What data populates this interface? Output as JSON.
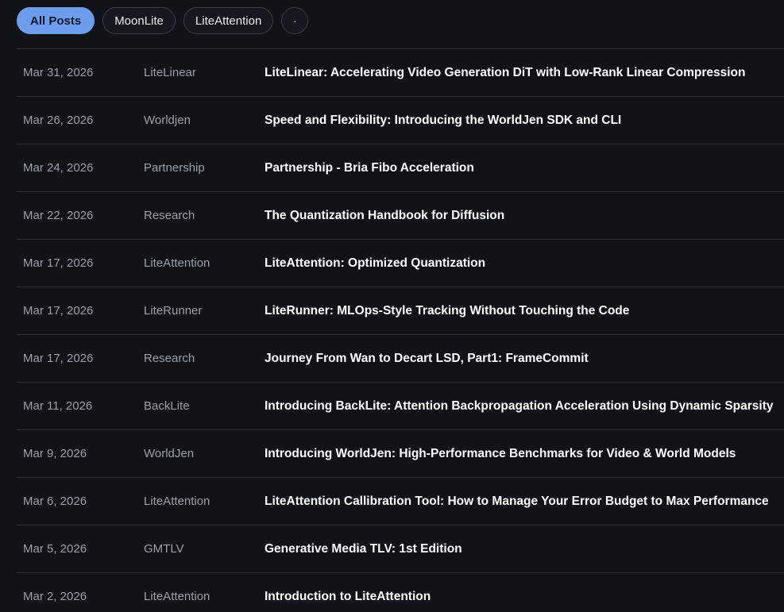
{
  "filters": {
    "all_posts": "All Posts",
    "moonlite": "MoonLite",
    "liteattention": "LiteAttention",
    "more": "·"
  },
  "posts": [
    {
      "date": "Mar 31, 2026",
      "category": "LiteLinear",
      "title": "LiteLinear: Accelerating Video Generation DiT with Low-Rank Linear Compression"
    },
    {
      "date": "Mar 26, 2026",
      "category": "Worldjen",
      "title": "Speed and Flexibility: Introducing the WorldJen SDK and CLI"
    },
    {
      "date": "Mar 24, 2026",
      "category": "Partnership",
      "title": "Partnership - Bria Fibo Acceleration"
    },
    {
      "date": "Mar 22, 2026",
      "category": "Research",
      "title": "The Quantization Handbook for Diffusion"
    },
    {
      "date": "Mar 17, 2026",
      "category": "LiteAttention",
      "title": "LiteAttention: Optimized Quantization"
    },
    {
      "date": "Mar 17, 2026",
      "category": "LiteRunner",
      "title": "LiteRunner: MLOps-Style Tracking Without Touching the Code"
    },
    {
      "date": "Mar 17, 2026",
      "category": "Research",
      "title": "Journey From Wan to Decart LSD, Part1: FrameCommit"
    },
    {
      "date": "Mar 11, 2026",
      "category": "BackLite",
      "title": "Introducing BackLite: Attention Backpropagation Acceleration Using Dynamic Sparsity"
    },
    {
      "date": "Mar 9, 2026",
      "category": "WorldJen",
      "title": "Introducing WorldJen: High-Performance Benchmarks for Video & World Models"
    },
    {
      "date": "Mar 6, 2026",
      "category": "LiteAttention",
      "title": "LiteAttention Callibration Tool: How to Manage Your Error Budget to Max Performance"
    },
    {
      "date": "Mar 5, 2026",
      "category": "GMTLV",
      "title": "Generative Media TLV: 1st Edition"
    },
    {
      "date": "Mar 2, 2026",
      "category": "LiteAttention",
      "title": "Introduction to LiteAttention"
    }
  ]
}
